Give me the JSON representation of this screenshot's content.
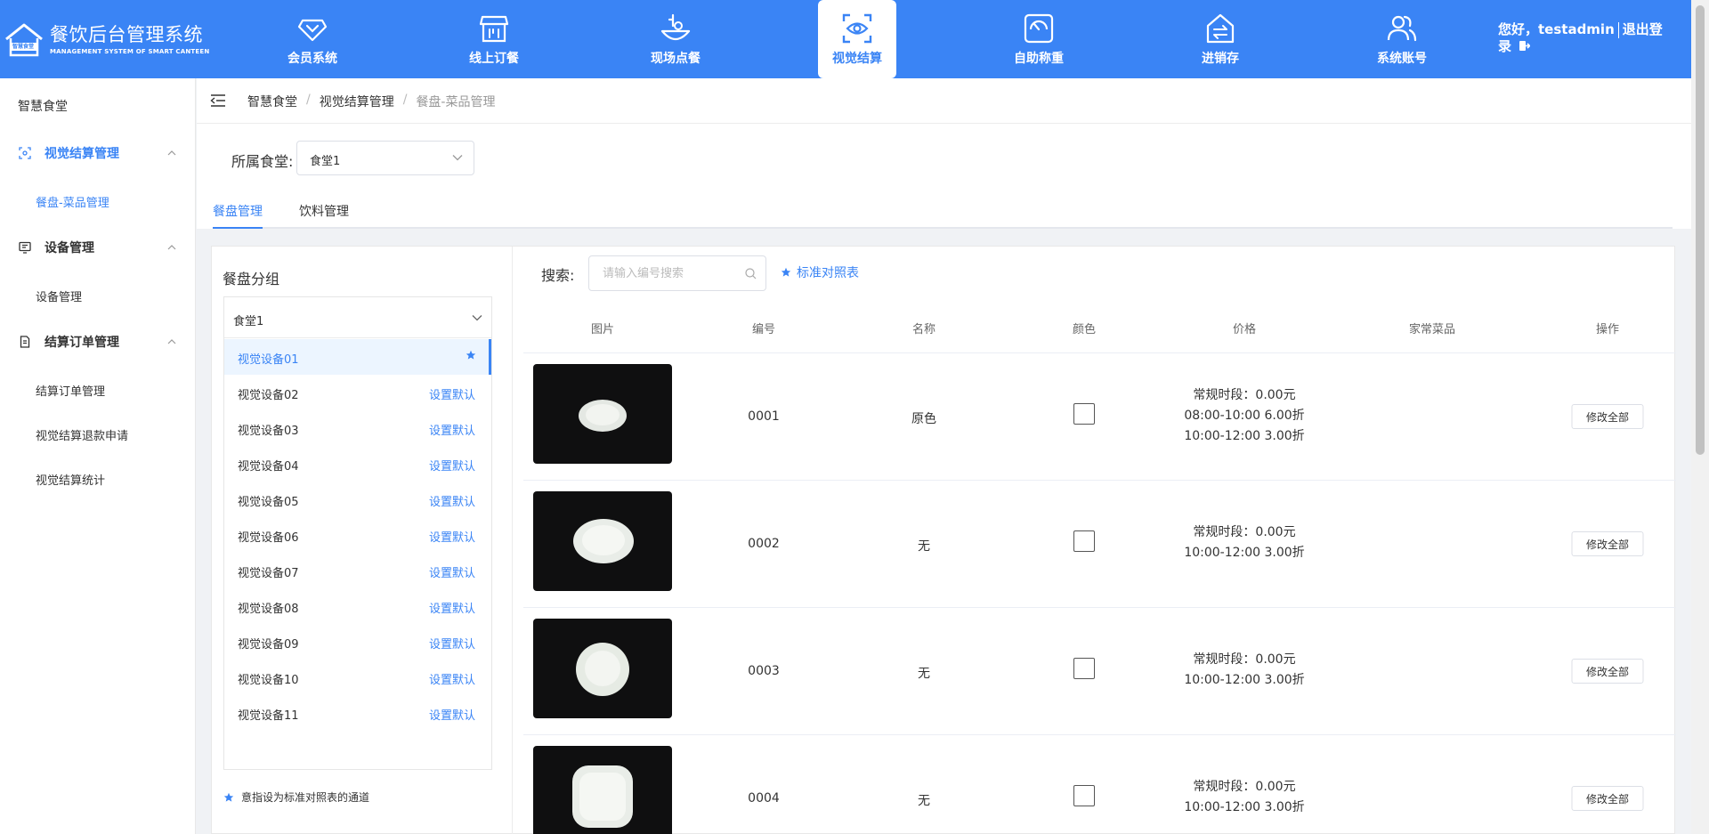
{
  "header": {
    "title": "餐饮后台管理系统",
    "subtitle": "MANAGEMENT SYSTEM OF SMART CANTEEN",
    "logo_text": "智慧食堂",
    "nav": [
      {
        "label": "会员系统",
        "icon": "diamond-icon"
      },
      {
        "label": "线上订餐",
        "icon": "storefront-icon"
      },
      {
        "label": "现场点餐",
        "icon": "dish-bowl-icon"
      },
      {
        "label": "视觉结算",
        "icon": "eye-scan-icon"
      },
      {
        "label": "自助称重",
        "icon": "scale-icon"
      },
      {
        "label": "进销存",
        "icon": "inventory-exchange-icon"
      },
      {
        "label": "系统账号",
        "icon": "users-icon"
      }
    ],
    "active_nav": "视觉结算",
    "user_greeting": "您好，testadmin",
    "logout_label": "退出登录"
  },
  "sidebar": {
    "title": "智慧食堂",
    "groups": [
      {
        "label": "视觉结算管理",
        "icon": "scan-icon",
        "items": [
          "餐盘-菜品管理"
        ]
      },
      {
        "label": "设备管理",
        "icon": "monitor-icon",
        "items": [
          "设备管理"
        ]
      },
      {
        "label": "结算订单管理",
        "icon": "document-icon",
        "items": [
          "结算订单管理",
          "视觉结算退款申请",
          "视觉结算统计"
        ]
      }
    ],
    "active_item": "餐盘-菜品管理"
  },
  "breadcrumb": [
    "智慧食堂",
    "视觉结算管理",
    "餐盘-菜品管理"
  ],
  "filter": {
    "label": "所属食堂:",
    "value": "食堂1"
  },
  "tabs": [
    "餐盘管理",
    "饮料管理"
  ],
  "active_tab": "餐盘管理",
  "plate_groups": {
    "title": "餐盘分组",
    "canteen": "食堂1",
    "devices": [
      {
        "name": "视觉设备01",
        "action": "",
        "is_default": true
      },
      {
        "name": "视觉设备02",
        "action": "设置默认"
      },
      {
        "name": "视觉设备03",
        "action": "设置默认"
      },
      {
        "name": "视觉设备04",
        "action": "设置默认"
      },
      {
        "name": "视觉设备05",
        "action": "设置默认"
      },
      {
        "name": "视觉设备06",
        "action": "设置默认"
      },
      {
        "name": "视觉设备07",
        "action": "设置默认"
      },
      {
        "name": "视觉设备08",
        "action": "设置默认"
      },
      {
        "name": "视觉设备09",
        "action": "设置默认"
      },
      {
        "name": "视觉设备10",
        "action": "设置默认"
      },
      {
        "name": "视觉设备11",
        "action": "设置默认"
      }
    ],
    "note": "意指设为标准对照表的通道"
  },
  "search": {
    "label": "搜索:",
    "placeholder": "请输入编号搜索",
    "value": "",
    "std_link": "标准对照表"
  },
  "table": {
    "columns": [
      "图片",
      "编号",
      "名称",
      "颜色",
      "价格",
      "家常菜品",
      "操作"
    ],
    "rows": [
      {
        "code": "0001",
        "name": "原色",
        "plate": "oval-small",
        "price_lines": [
          "常规时段：0.00元",
          "08:00-10:00  6.00折",
          "10:00-12:00  3.00折"
        ],
        "home_dish": "",
        "action": "修改全部"
      },
      {
        "code": "0002",
        "name": "无",
        "plate": "oval-large",
        "price_lines": [
          "常规时段：0.00元",
          "10:00-12:00  3.00折"
        ],
        "home_dish": "",
        "action": "修改全部"
      },
      {
        "code": "0003",
        "name": "无",
        "plate": "round",
        "price_lines": [
          "常规时段：0.00元",
          "10:00-12:00  3.00折"
        ],
        "home_dish": "",
        "action": "修改全部"
      },
      {
        "code": "0004",
        "name": "无",
        "plate": "square",
        "price_lines": [
          "常规时段：0.00元",
          "10:00-12:00  3.00折"
        ],
        "home_dish": "",
        "action": "修改全部"
      }
    ]
  },
  "colors": {
    "primary": "#3a84f5",
    "header_bg": "#3a84f5",
    "active_row_bg": "#ecf5ff",
    "plate_photo_bg": "#0f0f10"
  }
}
